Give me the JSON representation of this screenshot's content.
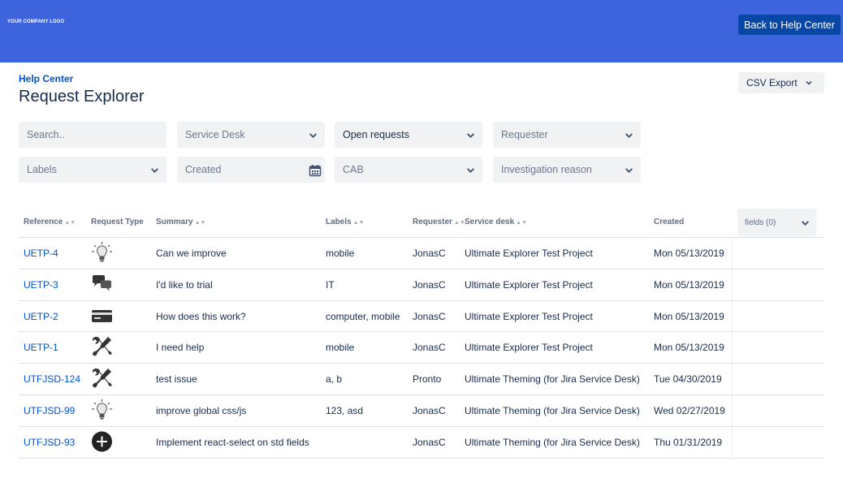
{
  "header": {
    "logo_text": "YOUR COMPANY LOGO",
    "back_label": "Back to Help Center",
    "brand_color": "#3d63dd"
  },
  "breadcrumb": "Help Center",
  "title": "Request Explorer",
  "csv_export_label": "CSV Export",
  "filters": {
    "search_placeholder": "Search..",
    "service_desk": "Service Desk",
    "open_requests": "Open requests",
    "requester": "Requester",
    "labels": "Labels",
    "created": "Created",
    "cab": "CAB",
    "investigation_reason": "Investigation reason"
  },
  "table": {
    "columns": {
      "reference": "Reference",
      "request_type": "Request Type",
      "summary": "Summary",
      "labels": "Labels",
      "requester": "Requester",
      "service_desk": "Service desk",
      "created": "Created"
    },
    "fields_button": "fields (0)",
    "rows": [
      {
        "ref": "UETP-4",
        "type_icon": "lightbulb-icon",
        "summary": "Can we improve",
        "labels": "mobile",
        "requester": "JonasC",
        "service_desk": "Ultimate Explorer Test Project",
        "created": "Mon 05/13/2019"
      },
      {
        "ref": "UETP-3",
        "type_icon": "chat-bubbles-icon",
        "summary": "I'd like to trial",
        "labels": "IT",
        "requester": "JonasC",
        "service_desk": "Ultimate Explorer Test Project",
        "created": "Mon 05/13/2019"
      },
      {
        "ref": "UETP-2",
        "type_icon": "credit-card-icon",
        "summary": "How does this work?",
        "labels": "computer, mobile",
        "requester": "JonasC",
        "service_desk": "Ultimate Explorer Test Project",
        "created": "Mon 05/13/2019"
      },
      {
        "ref": "UETP-1",
        "type_icon": "wrench-tools-icon",
        "summary": "I need help",
        "labels": "mobile",
        "requester": "JonasC",
        "service_desk": "Ultimate Explorer Test Project",
        "created": "Mon 05/13/2019"
      },
      {
        "ref": "UTFJSD-124",
        "type_icon": "wrench-tools-icon",
        "summary": "test issue",
        "labels": "a, b",
        "requester": "Pronto",
        "service_desk": "Ultimate Theming (for Jira Service Desk)",
        "created": "Tue 04/30/2019"
      },
      {
        "ref": "UTFJSD-99",
        "type_icon": "lightbulb-icon",
        "summary": "improve global css/js",
        "labels": "123, asd",
        "requester": "JonasC",
        "service_desk": "Ultimate Theming (for Jira Service Desk)",
        "created": "Wed 02/27/2019"
      },
      {
        "ref": "UTFJSD-93",
        "type_icon": "plus-circle-icon",
        "summary": "Implement react-select on std fields",
        "labels": "",
        "requester": "JonasC",
        "service_desk": "Ultimate Theming (for Jira Service Desk)",
        "created": "Thu 01/31/2019"
      }
    ]
  }
}
